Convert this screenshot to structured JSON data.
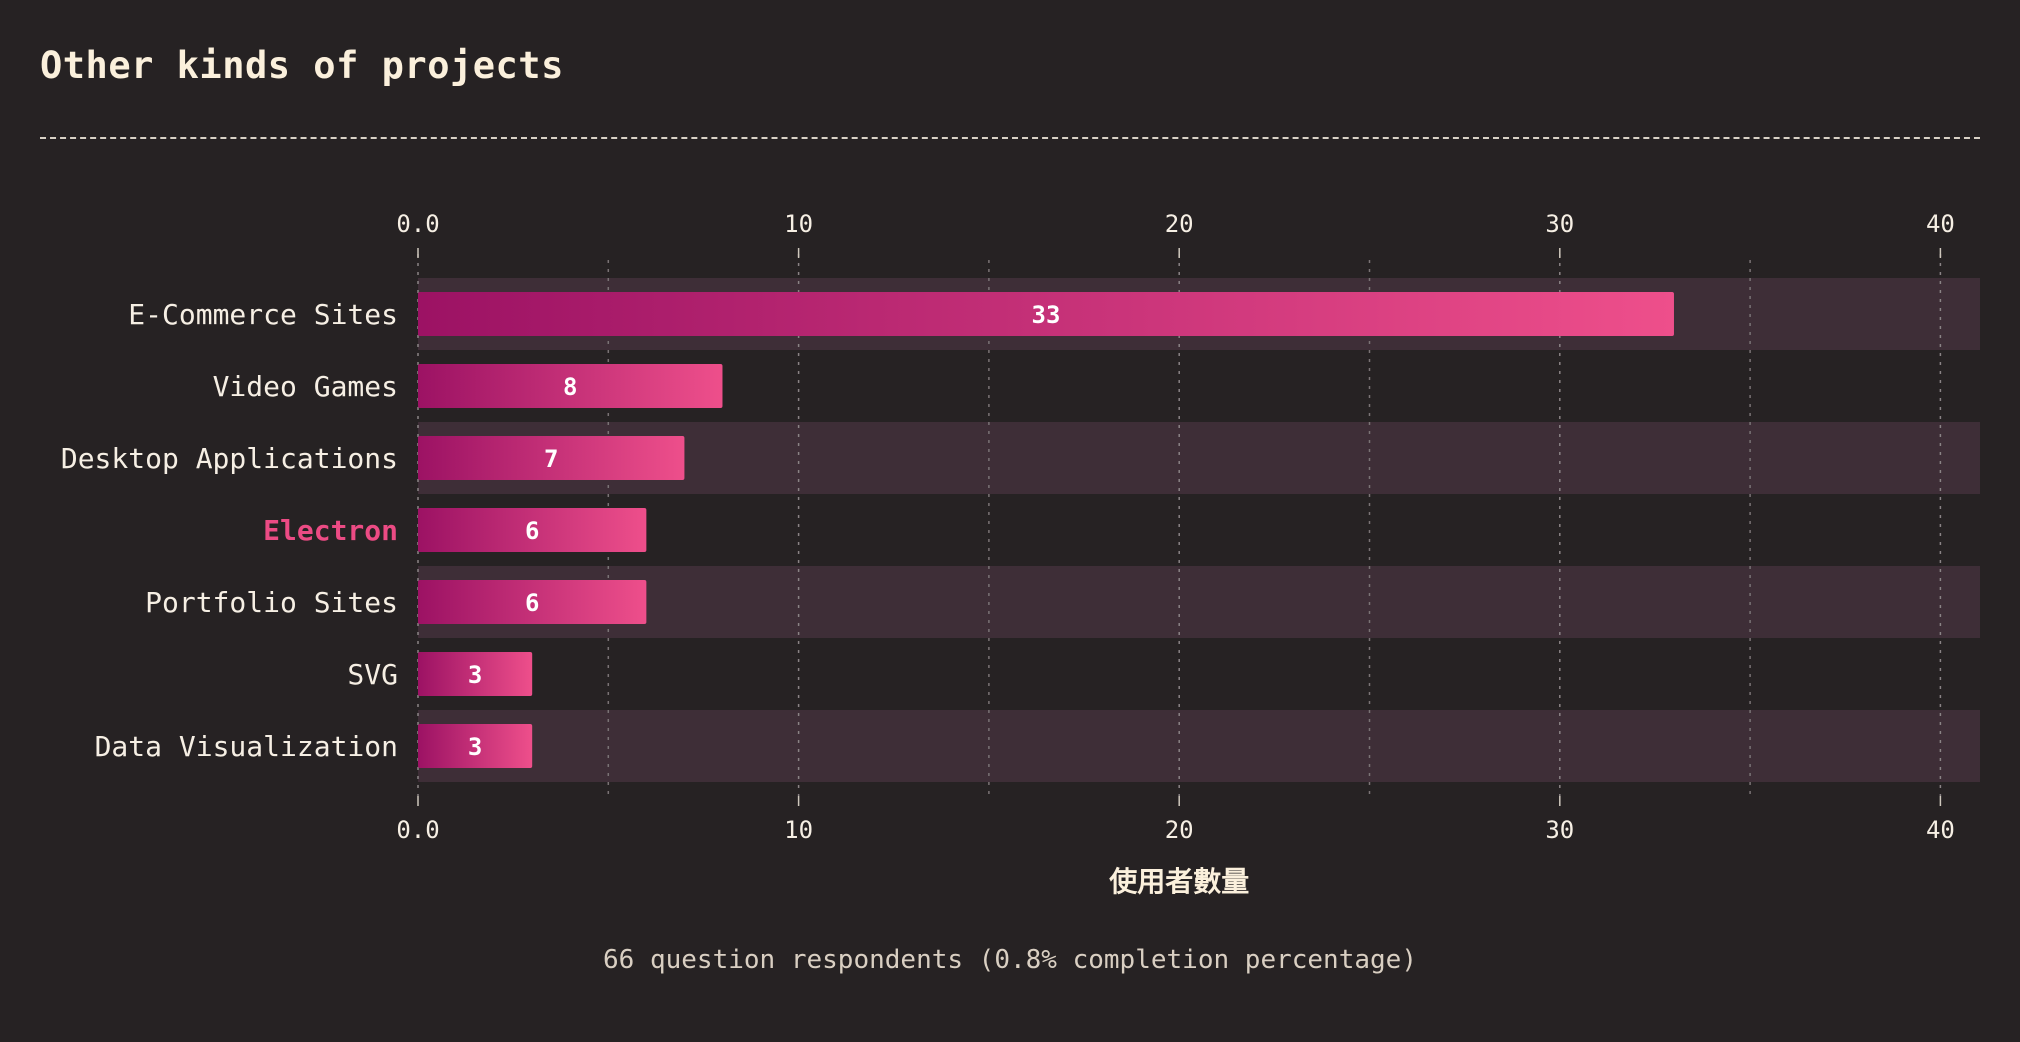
{
  "header": {
    "title": "Other kinds of projects"
  },
  "footer": {
    "respondents": "66 question respondents (0.8% completion percentage)"
  },
  "colors": {
    "background": "#262223",
    "row_stripe": "#3e2e37",
    "bar_start": "#9c1264",
    "bar_end": "#ee4f8b",
    "highlight": "#ec4b84",
    "text": "#f6efe4"
  },
  "chart_data": {
    "type": "bar",
    "orientation": "horizontal",
    "categories": [
      "E-Commerce Sites",
      "Video Games",
      "Desktop Applications",
      "Electron",
      "Portfolio Sites",
      "SVG",
      "Data Visualization"
    ],
    "values": [
      33,
      8,
      7,
      6,
      6,
      3,
      3
    ],
    "highlighted_category": "Electron",
    "xlabel": "使用者數量",
    "ylabel": "",
    "xlim": [
      0,
      41
    ],
    "xticks": [
      0,
      10,
      20,
      30,
      40
    ],
    "xtick_labels": [
      "0.0",
      "10",
      "20",
      "30",
      "40"
    ],
    "minor_gridlines": [
      5,
      15,
      25,
      35
    ],
    "grid": true,
    "axis_top": true,
    "axis_bottom": true
  }
}
